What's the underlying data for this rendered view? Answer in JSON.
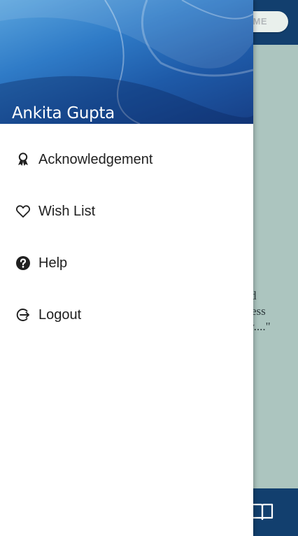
{
  "background_app": {
    "header_button_label": "ME",
    "quote_lines": [
      "and",
      "guess",
      "ary....\""
    ]
  },
  "drawer": {
    "user_name": "Ankita Gupta",
    "items": [
      {
        "label": "Acknowledgement",
        "icon": "award-icon"
      },
      {
        "label": "Wish List",
        "icon": "heart-icon"
      },
      {
        "label": "Help",
        "icon": "help-circle-icon"
      },
      {
        "label": "Logout",
        "icon": "logout-icon"
      }
    ]
  },
  "colors": {
    "app_bar": "#123f6e",
    "content_bg": "#acc5bf",
    "drawer_bg": "#ffffff",
    "header_blue": "#1e5aa8"
  }
}
